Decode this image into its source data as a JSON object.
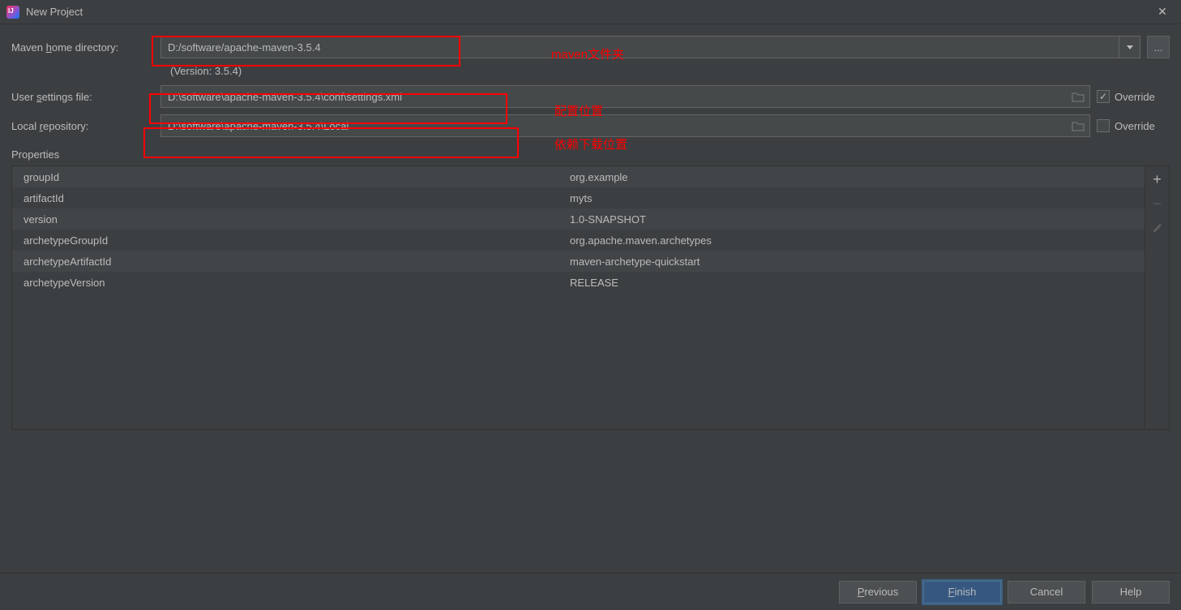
{
  "window": {
    "title": "New Project"
  },
  "labels": {
    "maven_home_pre": "Maven ",
    "maven_home_u": "h",
    "maven_home_post": "ome directory:",
    "user_settings_pre": "User ",
    "user_settings_u": "s",
    "user_settings_post": "ettings file:",
    "local_repo_pre": "Local ",
    "local_repo_u": "r",
    "local_repo_post": "epository:",
    "override": "Override",
    "properties": "Properties",
    "browse": "..."
  },
  "fields": {
    "maven_home": "D:/software/apache-maven-3.5.4",
    "version": "(Version: 3.5.4)",
    "user_settings": "D:\\software\\apache-maven-3.5.4\\conf\\settings.xml",
    "local_repo": "D:\\software\\apache-maven-3.5.4\\Local"
  },
  "annotations": {
    "maven_folder": "maven文件夹",
    "config_location": "配置位置",
    "dep_location": "依赖下载位置"
  },
  "properties": [
    {
      "key": "groupId",
      "value": "org.example"
    },
    {
      "key": "artifactId",
      "value": "myts"
    },
    {
      "key": "version",
      "value": "1.0-SNAPSHOT"
    },
    {
      "key": "archetypeGroupId",
      "value": "org.apache.maven.archetypes"
    },
    {
      "key": "archetypeArtifactId",
      "value": "maven-archetype-quickstart"
    },
    {
      "key": "archetypeVersion",
      "value": "RELEASE"
    }
  ],
  "buttons": {
    "previous_u": "P",
    "previous_post": "revious",
    "finish_u": "F",
    "finish_post": "inish",
    "cancel": "Cancel",
    "help": "Help"
  }
}
